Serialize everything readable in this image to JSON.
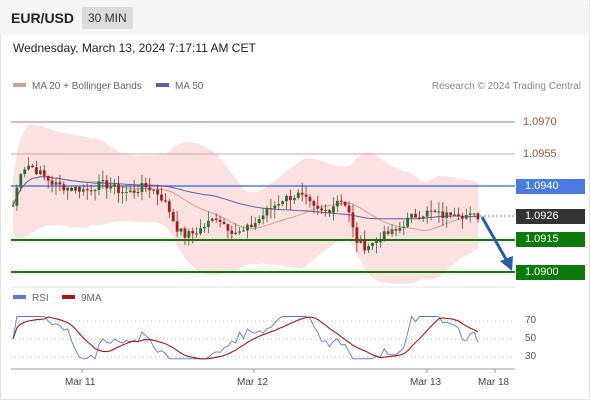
{
  "header": {
    "symbol": "EUR/USD",
    "timeframe": "30 MIN",
    "datetime": "Wednesday, March 13, 2024 7:17:11 AM CET"
  },
  "legend": {
    "ma20": "MA 20 + Bollinger Bands",
    "ma50": "MA 50",
    "copyright": "Research © 2024 Trading Central",
    "rsi": "RSI",
    "rsi_ma": "9MA"
  },
  "colors": {
    "ma20": "#d4a08c",
    "ma50": "#5a5fa8",
    "bands": "#fbd9d9",
    "resistance_line": "#b07a6a",
    "blue_level": "#4a7be0",
    "support_green": "#0b7a0b",
    "current_price_tag": "#333333",
    "candle_up": "#2e6b2e",
    "candle_down": "#a02020",
    "forecast_arrow": "#2a5aa8",
    "rsi": "#5878d8",
    "rsi_ma": "#a01818"
  },
  "levels": [
    {
      "label": "1.0970",
      "style": "text"
    },
    {
      "label": "1.0955",
      "style": "text"
    },
    {
      "label": "1.0940",
      "style": "tag-blue"
    },
    {
      "label": "1.0926",
      "style": "tag-current"
    },
    {
      "label": "1.0915",
      "style": "tag-green"
    },
    {
      "label": "1.0900",
      "style": "tag-green"
    }
  ],
  "rsi_levels": [
    "70",
    "50",
    "30"
  ],
  "x_labels": [
    "Mar 11",
    "Mar 12",
    "Mar 13",
    "Mar 18"
  ],
  "chart_data": {
    "type": "candlestick",
    "y_range": [
      1.0895,
      1.098
    ],
    "x_labels": [
      "Mar 11",
      "Mar 12",
      "Mar 13",
      "Mar 18"
    ],
    "close_path": [
      1.0931,
      1.0948,
      1.095,
      1.0947,
      1.0944,
      1.0941,
      1.094,
      1.0939,
      1.0939,
      1.0938,
      1.094,
      1.0941,
      1.094,
      1.0938,
      1.0937,
      1.0938,
      1.094,
      1.0939,
      1.0936,
      1.093,
      1.0921,
      1.0917,
      1.0918,
      1.092,
      1.0923,
      1.0926,
      1.0922,
      1.0919,
      1.0918,
      1.0921,
      1.0924,
      1.0928,
      1.0931,
      1.0934,
      1.0935,
      1.0936,
      1.0933,
      1.0929,
      1.0928,
      1.093,
      1.0935,
      1.093,
      1.0915,
      1.0912,
      1.0913,
      1.0916,
      1.0918,
      1.0919,
      1.0923,
      1.0926,
      1.0927,
      1.0928,
      1.0927,
      1.0926,
      1.0929,
      1.0927,
      1.0926,
      1.0926
    ],
    "forecast": {
      "from": 1.0926,
      "to": 1.09
    }
  }
}
